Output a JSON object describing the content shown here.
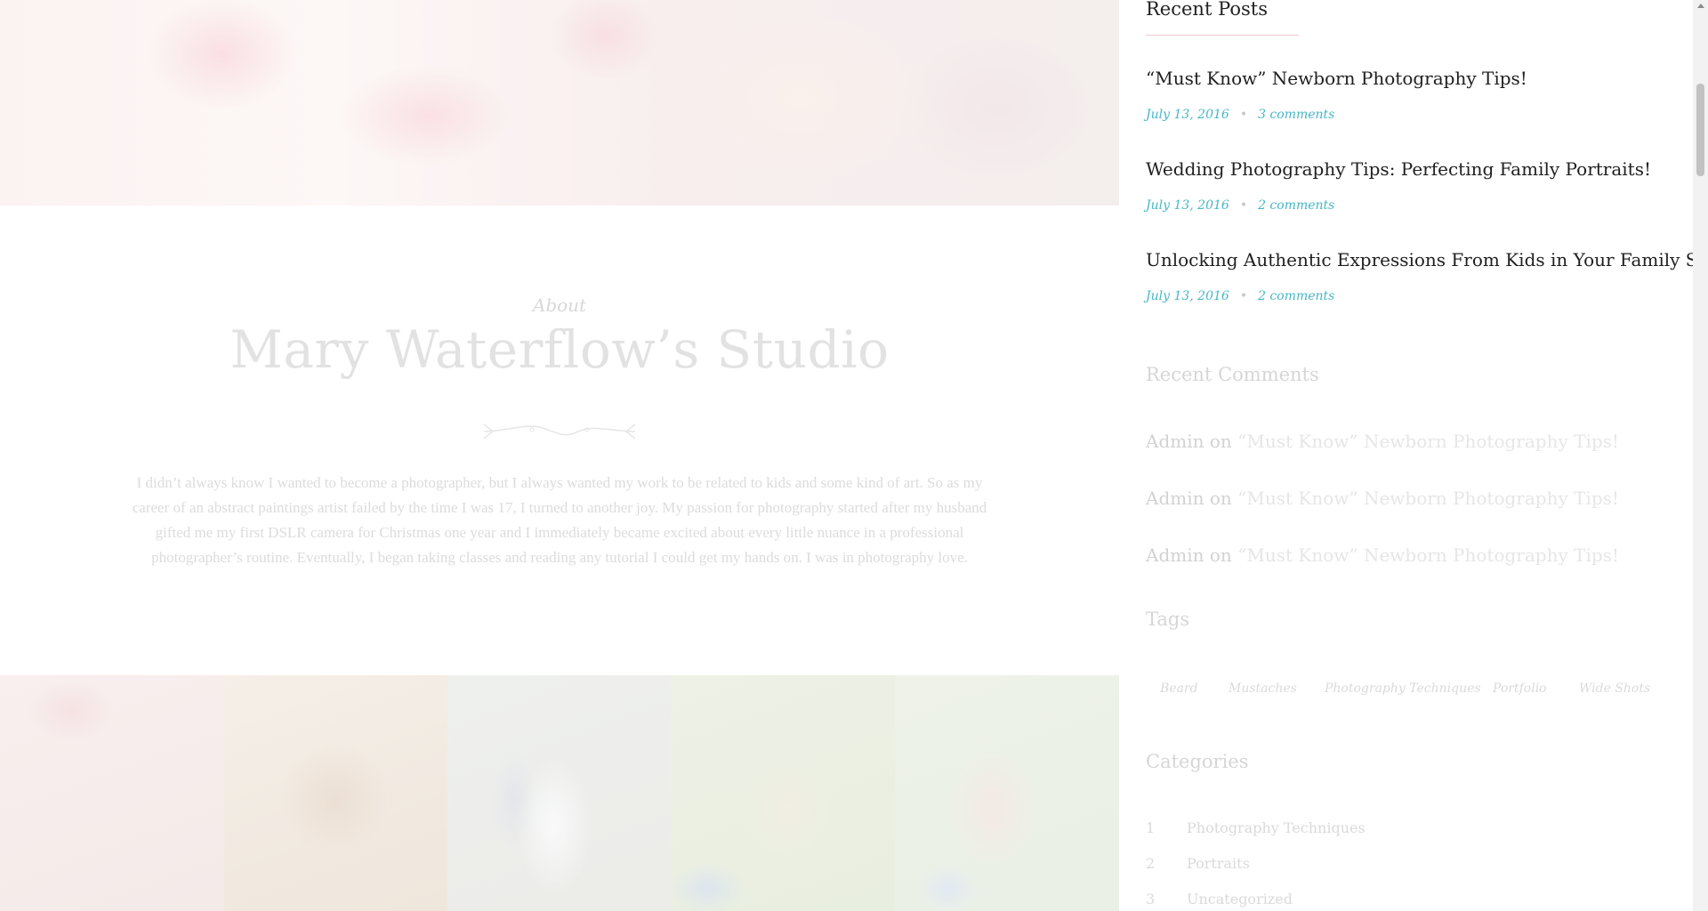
{
  "about": {
    "eyebrow": "About",
    "title": "Mary Waterflow’s Studio",
    "text": "I didn’t always know I wanted to become a photographer, but I always wanted my work to be related to kids and some kind of art. So as my career of an abstract paintings artist failed by the time I was 17, I turned to another joy. My passion for photography started after my husband gifted me my first DSLR camera for Christmas one year and I immediately became excited about every little nuance in a professional photographer’s routine. Eventually, I began taking classes and reading any tutorial I could get my hands on. I was in photography love."
  },
  "sidebar": {
    "recent_posts": {
      "title": "Recent Posts",
      "items": [
        {
          "title": "“Must Know” Newborn Photography Tips!",
          "date": "July 13, 2016",
          "comments": "3 comments"
        },
        {
          "title": "Wedding Photography Tips: Perfecting Family Portraits!",
          "date": "July 13, 2016",
          "comments": "2 comments"
        },
        {
          "title": "Unlocking Authentic Expressions From Kids in Your Family Sessions",
          "date": "July 13, 2016",
          "comments": "2 comments"
        }
      ]
    },
    "recent_comments": {
      "title": "Recent Comments",
      "items": [
        {
          "author": "Admin",
          "on": "on",
          "post": "“Must Know” Newborn Photography Tips!"
        },
        {
          "author": "Admin",
          "on": "on",
          "post": "“Must Know” Newborn Photography Tips!"
        },
        {
          "author": "Admin",
          "on": "on",
          "post": "“Must Know” Newborn Photography Tips!"
        }
      ]
    },
    "tags": {
      "title": "Tags",
      "items": [
        "Beard",
        "Mustaches",
        "Photography Techniques",
        "Portfolio",
        "Wide Shots"
      ]
    },
    "categories": {
      "title": "Categories",
      "items": [
        {
          "num": "1",
          "name": "Photography Techniques"
        },
        {
          "num": "2",
          "name": "Portraits"
        },
        {
          "num": "3",
          "name": "Uncategorized"
        }
      ]
    }
  },
  "colors": {
    "accent": "#46b7c6",
    "underline": "#f0c8cf"
  }
}
